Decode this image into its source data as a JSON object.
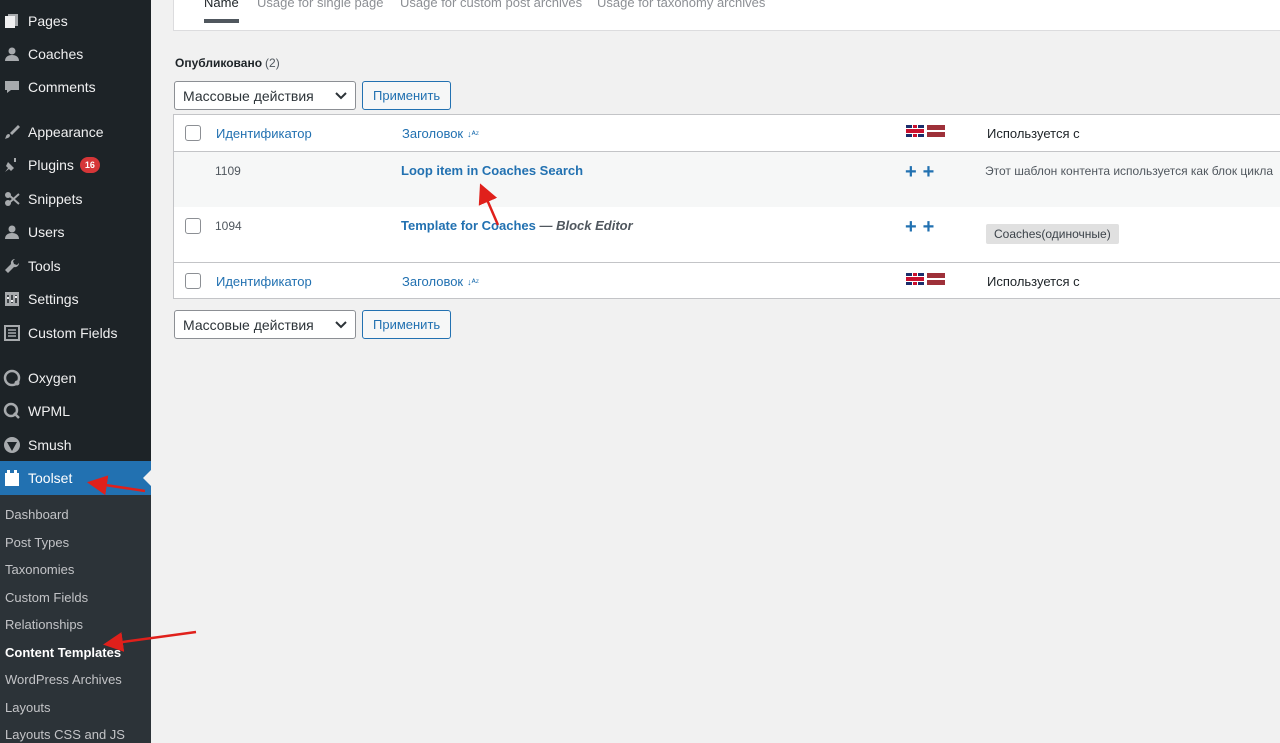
{
  "sidebar": {
    "items": [
      {
        "label": "Pages",
        "icon": "pages-icon"
      },
      {
        "label": "Coaches",
        "icon": "user-icon"
      },
      {
        "label": "Comments",
        "icon": "comment-icon"
      },
      {
        "label": "Appearance",
        "icon": "paintbrush-icon"
      },
      {
        "label": "Plugins",
        "icon": "plugin-icon",
        "badge": "16"
      },
      {
        "label": "Snippets",
        "icon": "snippets-icon"
      },
      {
        "label": "Users",
        "icon": "users-icon"
      },
      {
        "label": "Tools",
        "icon": "wrench-icon"
      },
      {
        "label": "Settings",
        "icon": "settings-icon"
      },
      {
        "label": "Custom Fields",
        "icon": "custom-fields-icon"
      },
      {
        "label": "Oxygen",
        "icon": "oxygen-icon"
      },
      {
        "label": "WPML",
        "icon": "wpml-icon"
      },
      {
        "label": "Smush",
        "icon": "smush-icon"
      },
      {
        "label": "Toolset",
        "icon": "toolset-icon",
        "active": true
      }
    ],
    "submenu": [
      "Dashboard",
      "Post Types",
      "Taxonomies",
      "Custom Fields",
      "Relationships",
      "Content Templates",
      "WordPress Archives",
      "Layouts",
      "Layouts CSS and JS"
    ],
    "current_submenu": "Content Templates"
  },
  "tabs": [
    "Name",
    "Usage for single page",
    "Usage for custom post archives",
    "Usage for taxonomy archives"
  ],
  "status": {
    "label": "Опубликовано",
    "count": "(2)"
  },
  "bulk": {
    "select_label": "Массовые действия",
    "apply_label": "Применить"
  },
  "table": {
    "headers": {
      "id": "Идентификатор",
      "title": "Заголовок",
      "used": "Используется с"
    },
    "rows": [
      {
        "id": "1109",
        "title": "Loop item in Coaches Search",
        "suffix": "",
        "used_text": "Этот шаблон контента используется как блок цикла"
      },
      {
        "id": "1094",
        "title": "Template for Coaches",
        "suffix": "— Block Editor",
        "used_tag": "Coaches(одиночные)"
      }
    ]
  },
  "colors": {
    "sidebar_bg": "#1d2327",
    "accent": "#2271b1",
    "arrow": "#e0201b"
  }
}
